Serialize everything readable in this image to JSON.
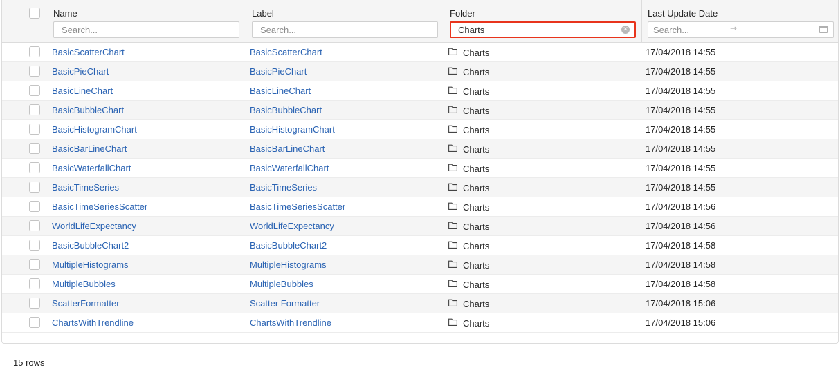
{
  "columns": {
    "name": {
      "title": "Name",
      "placeholder": "Search..."
    },
    "label": {
      "title": "Label",
      "placeholder": "Search..."
    },
    "folder": {
      "title": "Folder",
      "value": "Charts"
    },
    "date": {
      "title": "Last Update Date",
      "placeholder": "Search..."
    }
  },
  "icons": {
    "clear": "clear-circle-icon",
    "folder": "folder-icon",
    "arrow": "arrow-right-icon",
    "calendar": "calendar-icon"
  },
  "colors": {
    "link": "#2a63b3",
    "highlight_border": "#e8341c",
    "header_bg": "#f5f5f5",
    "alt_row_bg": "#f5f5f5"
  },
  "rows": [
    {
      "name": "BasicScatterChart",
      "label": "BasicScatterChart",
      "folder": "Charts",
      "date": "17/04/2018 14:55"
    },
    {
      "name": "BasicPieChart",
      "label": "BasicPieChart",
      "folder": "Charts",
      "date": "17/04/2018 14:55"
    },
    {
      "name": "BasicLineChart",
      "label": "BasicLineChart",
      "folder": "Charts",
      "date": "17/04/2018 14:55"
    },
    {
      "name": "BasicBubbleChart",
      "label": "BasicBubbleChart",
      "folder": "Charts",
      "date": "17/04/2018 14:55"
    },
    {
      "name": "BasicHistogramChart",
      "label": "BasicHistogramChart",
      "folder": "Charts",
      "date": "17/04/2018 14:55"
    },
    {
      "name": "BasicBarLineChart",
      "label": "BasicBarLineChart",
      "folder": "Charts",
      "date": "17/04/2018 14:55"
    },
    {
      "name": "BasicWaterfallChart",
      "label": "BasicWaterfallChart",
      "folder": "Charts",
      "date": "17/04/2018 14:55"
    },
    {
      "name": "BasicTimeSeries",
      "label": "BasicTimeSeries",
      "folder": "Charts",
      "date": "17/04/2018 14:55"
    },
    {
      "name": "BasicTimeSeriesScatter",
      "label": "BasicTimeSeriesScatter",
      "folder": "Charts",
      "date": "17/04/2018 14:56"
    },
    {
      "name": "WorldLifeExpectancy",
      "label": "WorldLifeExpectancy",
      "folder": "Charts",
      "date": "17/04/2018 14:56"
    },
    {
      "name": "BasicBubbleChart2",
      "label": "BasicBubbleChart2",
      "folder": "Charts",
      "date": "17/04/2018 14:58"
    },
    {
      "name": "MultipleHistograms",
      "label": "MultipleHistograms",
      "folder": "Charts",
      "date": "17/04/2018 14:58"
    },
    {
      "name": "MultipleBubbles",
      "label": "MultipleBubbles",
      "folder": "Charts",
      "date": "17/04/2018 14:58"
    },
    {
      "name": "ScatterFormatter",
      "label": "Scatter Formatter",
      "folder": "Charts",
      "date": "17/04/2018 15:06"
    },
    {
      "name": "ChartsWithTrendline",
      "label": "ChartsWithTrendline",
      "folder": "Charts",
      "date": "17/04/2018 15:06"
    }
  ],
  "footer": {
    "row_count": "15 rows"
  }
}
